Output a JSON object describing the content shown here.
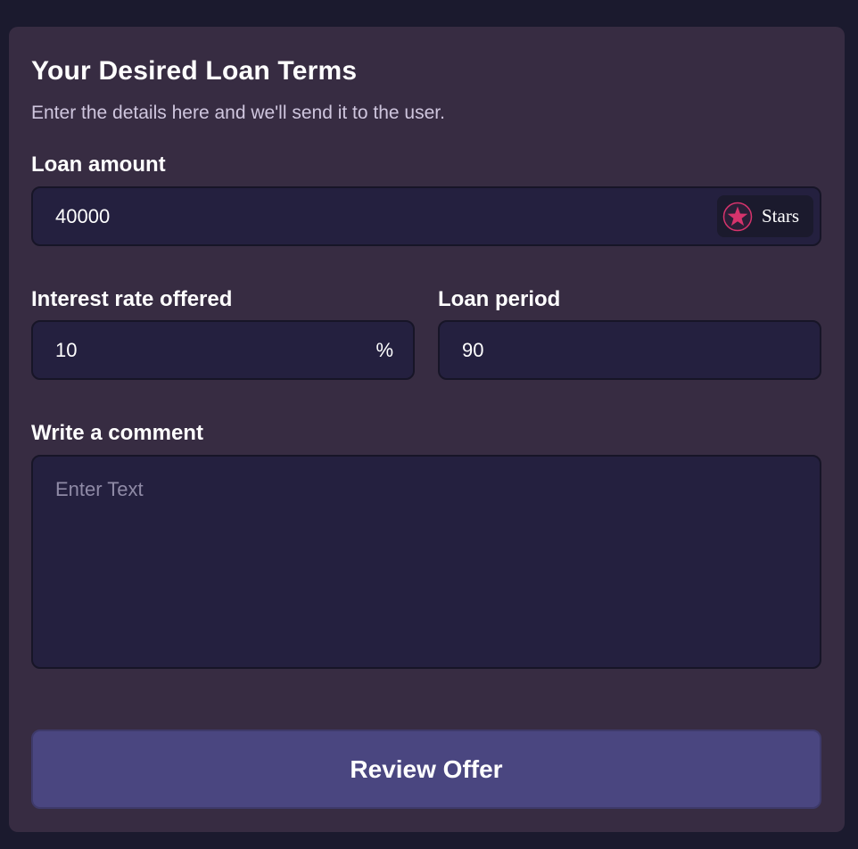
{
  "form": {
    "title": "Your Desired Loan Terms",
    "subtitle": "Enter the details here and we'll send it to the user.",
    "loan_amount": {
      "label": "Loan amount",
      "value": "40000",
      "currency_label": "Stars",
      "currency_icon": "star-coin-icon"
    },
    "interest_rate": {
      "label": "Interest rate offered",
      "value": "10",
      "suffix": "%"
    },
    "loan_period": {
      "label": "Loan period",
      "value": "90"
    },
    "comment": {
      "label": "Write a comment",
      "value": "",
      "placeholder": "Enter Text"
    },
    "submit_label": "Review Offer"
  },
  "colors": {
    "background": "#1b1a2e",
    "card": "#372c42",
    "field": "#24203f",
    "button": "#4a4680",
    "star_accent": "#d6336c"
  }
}
